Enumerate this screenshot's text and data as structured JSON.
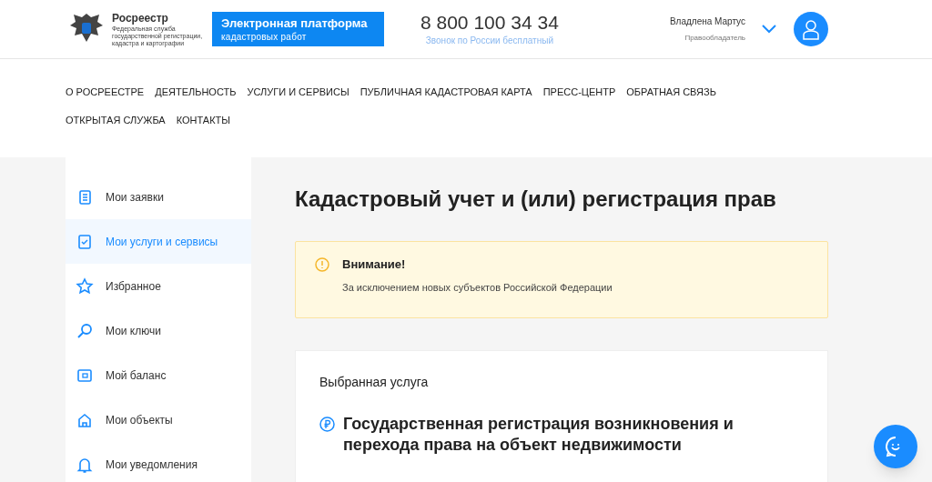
{
  "header": {
    "logo_title": "Росреестр",
    "logo_subtitle": "Федеральная служба государственной регистрации, кадастра и картографии",
    "platform_title": "Электронная платформа",
    "platform_subtitle": "кадастровых работ",
    "phone": "8 800 100 34 34",
    "phone_note": "Звонок по России бесплатный",
    "user_name": "Владлена Мартус",
    "user_role": "Правообладатель"
  },
  "nav": [
    "О РОСРЕЕСТРЕ",
    "ДЕЯТЕЛЬНОСТЬ",
    "УСЛУГИ И СЕРВИСЫ",
    "ПУБЛИЧНАЯ КАДАСТРОВАЯ КАРТА",
    "ПРЕСС-ЦЕНТР",
    "ОБРАТНАЯ СВЯЗЬ",
    "ОТКРЫТАЯ СЛУЖБА",
    "КОНТАКТЫ"
  ],
  "sidebar": {
    "items": [
      {
        "label": "Мои заявки",
        "kind": "document",
        "selected": false
      },
      {
        "label": "Мои услуги и сервисы",
        "kind": "checklist",
        "selected": true
      },
      {
        "label": "Избранное",
        "kind": "star",
        "selected": false
      },
      {
        "label": "Мои ключи",
        "kind": "key",
        "selected": false
      },
      {
        "label": "Мой баланс",
        "kind": "wallet",
        "selected": false
      },
      {
        "label": "Мои объекты",
        "kind": "house",
        "selected": false
      },
      {
        "label": "Мои уведомления",
        "kind": "bell",
        "selected": false
      }
    ]
  },
  "page_title": "Кадастровый учет и (или) регистрация прав",
  "alert": {
    "title": "Внимание!",
    "text": "За исключением новых субъектов Российской Федерации"
  },
  "service_card": {
    "heading": "Выбранная услуга",
    "service": "Государственная регистрация возникновения и перехода права на объект недвижимости"
  }
}
